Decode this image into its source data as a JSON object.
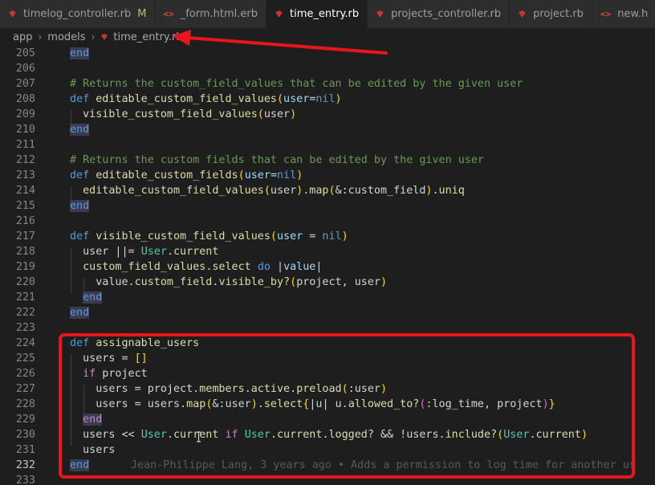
{
  "tabs": [
    {
      "label": "timelog_controller.rb",
      "badge": "M",
      "icon": "ruby-icon",
      "active": false
    },
    {
      "label": "_form.html.erb",
      "icon": "html-icon",
      "active": false
    },
    {
      "label": "time_entry.rb",
      "icon": "ruby-icon",
      "active": true
    },
    {
      "label": "projects_controller.rb",
      "icon": "ruby-icon",
      "active": false
    },
    {
      "label": "project.rb",
      "icon": "ruby-icon",
      "active": false
    },
    {
      "label": "new.h",
      "icon": "html-icon",
      "active": false
    }
  ],
  "breadcrumb": {
    "items": [
      "app",
      "models",
      "time_entry.rb"
    ],
    "separator": "›"
  },
  "editor": {
    "line_numbers": [
      "205",
      "206",
      "207",
      "208",
      "209",
      "210",
      "211",
      "212",
      "213",
      "214",
      "215",
      "216",
      "217",
      "218",
      "219",
      "220",
      "221",
      "222",
      "223",
      "224",
      "225",
      "226",
      "227",
      "228",
      "229",
      "230",
      "231",
      "232",
      "233"
    ],
    "current_line": "232",
    "blame": "Jean-Philippe Lang, 3 years ago • Adds a permission to log time for another us"
  },
  "colors": {
    "annotation": "#e8161b",
    "keyword": "#c586c0",
    "def": "#569cd6",
    "function": "#dcdcaa",
    "comment": "#6a9955",
    "class": "#4ec9b0"
  }
}
